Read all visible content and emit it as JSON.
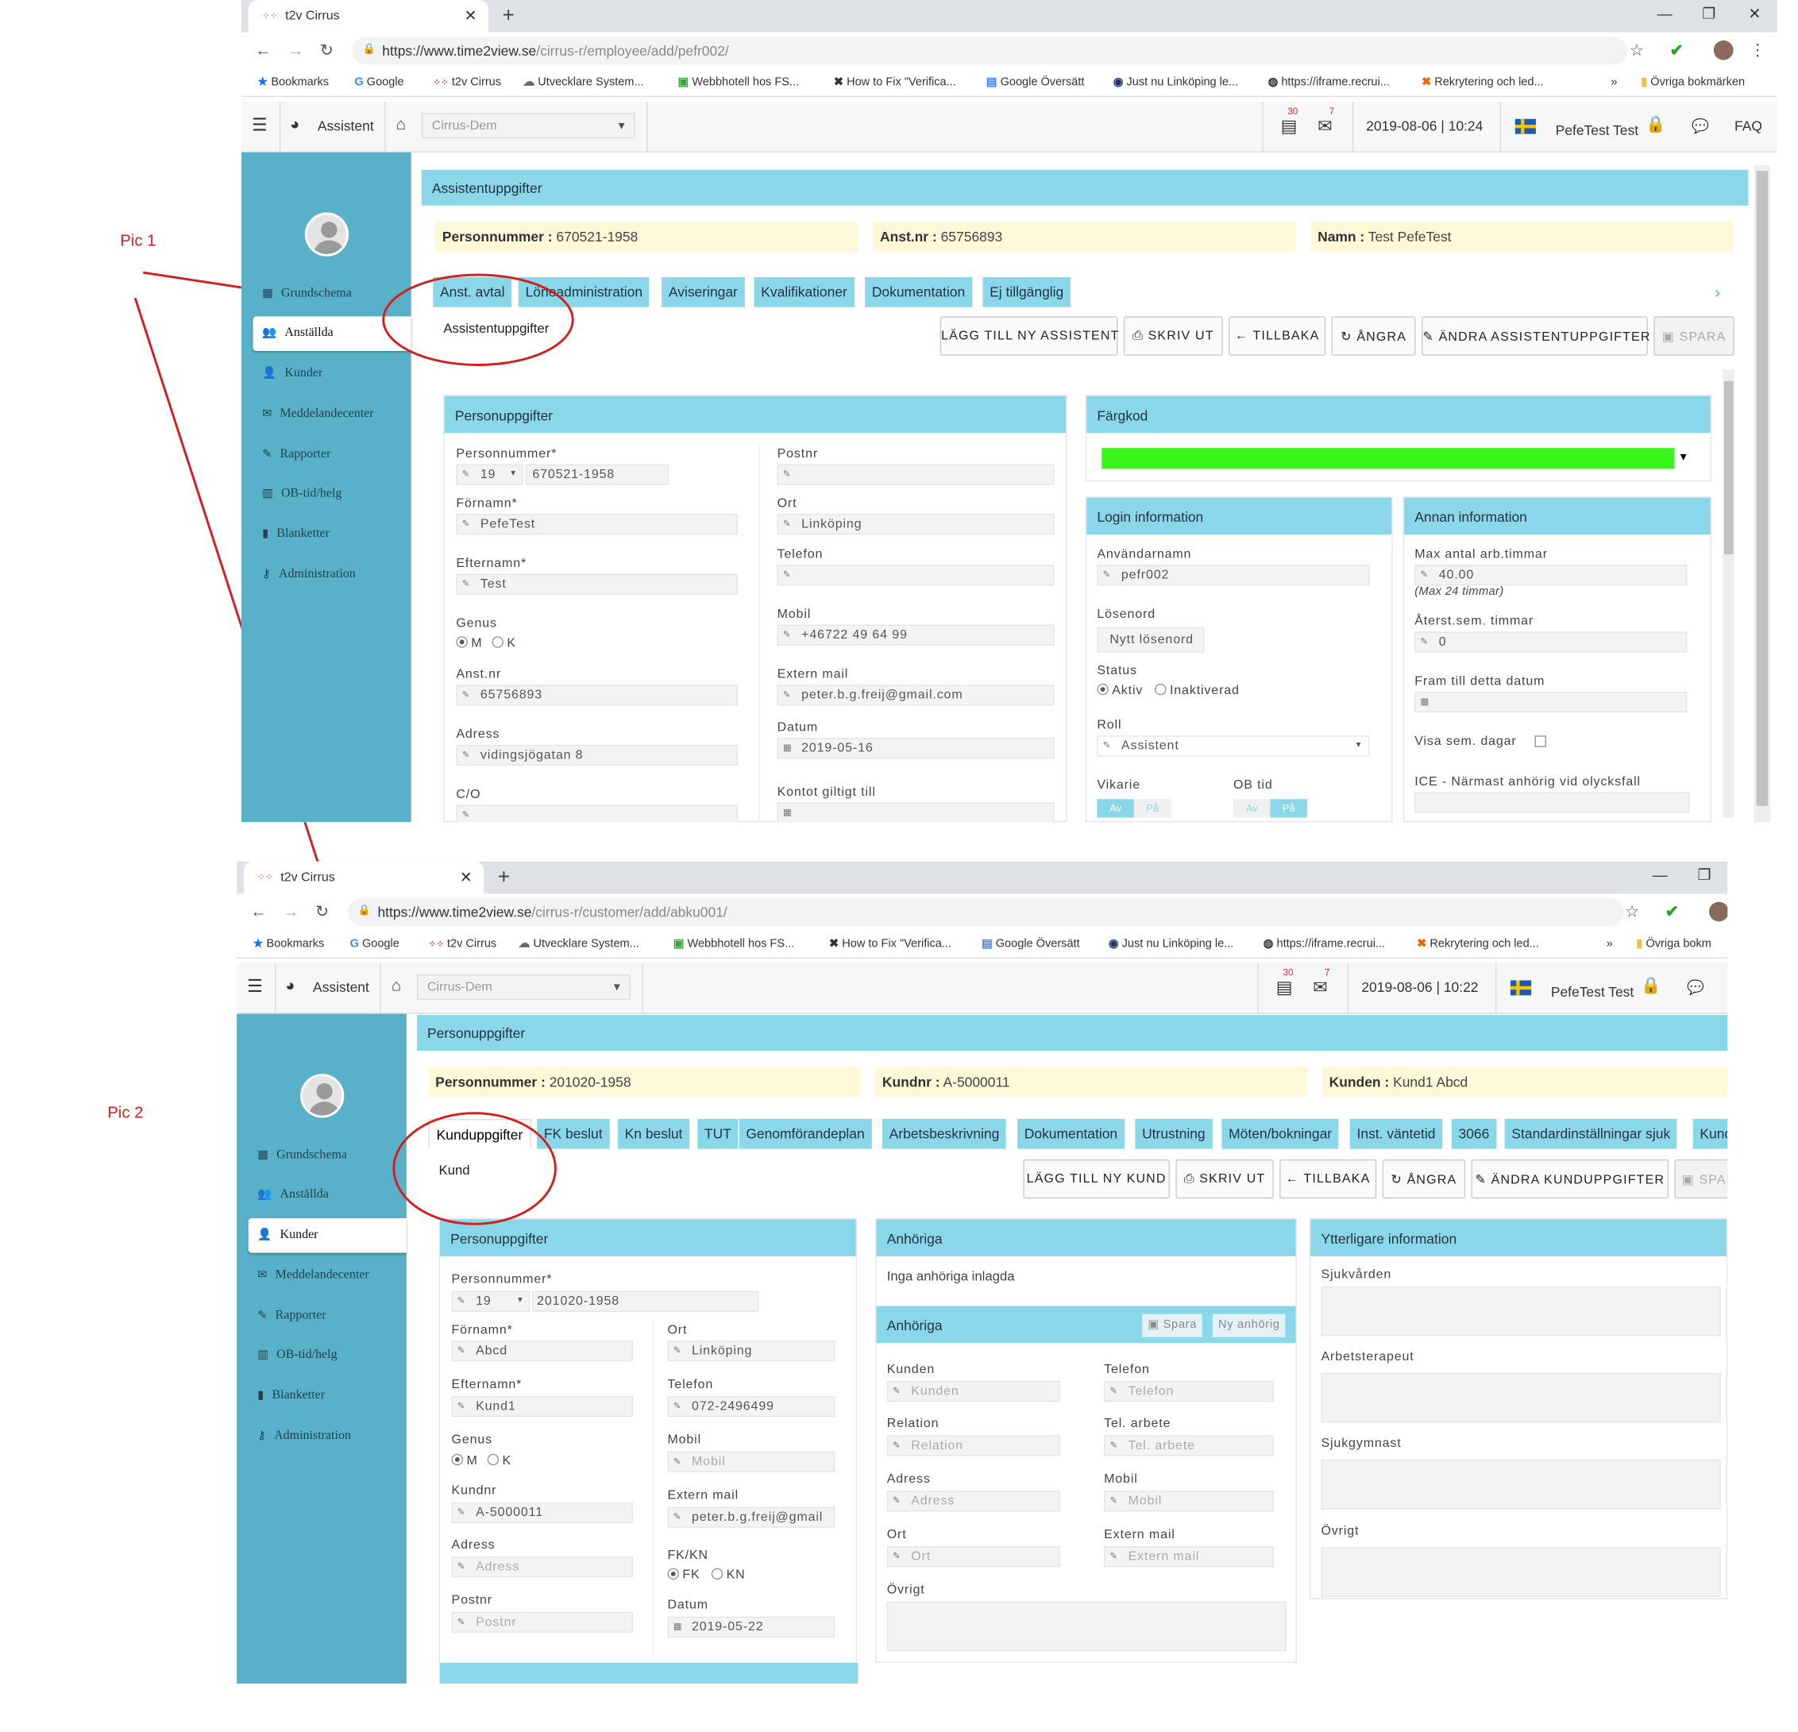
{
  "annotations": {
    "pic1": "Pic 1",
    "pic2": "Pic 2"
  },
  "colors": {
    "annotation": "#d21f1f",
    "sidebar": "#58b0c9",
    "header_blue": "#8bd7ea",
    "info_yellow": "#fcf8d8",
    "color_code": "#39f61a"
  },
  "browser": {
    "tab_title": "t2v Cirrus",
    "new_tab": "+",
    "bookmarks": [
      "Bookmarks",
      "Google",
      "t2v Cirrus",
      "Utvecklare System...",
      "Webbhotell hos FS...",
      "How to Fix \"Verifica...",
      "Google Översätt",
      "Just nu Linköping le...",
      "https://iframe.recrui...",
      "Rekrytering och led..."
    ],
    "more": "»",
    "other_bookmarks": "Övriga bokmärken",
    "other_bookmarks_cut": "Övriga bokm"
  },
  "app": {
    "module": "Assistent",
    "org_select": "Cirrus-Dem",
    "badge1": "30",
    "badge2": "7",
    "user": "PefeTest Test",
    "faq": "FAQ",
    "sidebar": [
      "Grundschema",
      "Anställda",
      "Kunder",
      "Meddelandecenter",
      "Rapporter",
      "OB-tid/helg",
      "Blanketter",
      "Administration"
    ]
  },
  "shot1": {
    "url_base": "https://www.time2view.se",
    "url_path": "/cirrus-r/employee/add/pefr002/",
    "datetime": "2019-08-06 | 10:24",
    "page_title": "Assistentuppgifter",
    "info": [
      {
        "label": "Personnummer :",
        "value": " 670521-1958"
      },
      {
        "label": "Anst.nr :",
        "value": " 65756893"
      },
      {
        "label": "Namn :",
        "value": " Test PefeTest"
      }
    ],
    "tabs": [
      "Anst. avtal",
      "Löneadministration",
      "Aviseringar",
      "Kvalifikationer",
      "Dokumentation",
      "Ej tillgänglig"
    ],
    "subtitle": "Assistentuppgifter",
    "buttons": [
      "LÄGG TILL NY ASSISTENT",
      "SKRIV UT",
      "TILLBAKA",
      "ÅNGRA",
      "ÄNDRA ASSISTENTUPPGIFTER",
      "SPARA"
    ],
    "person": {
      "header": "Personuppgifter",
      "personnummer_label": "Personnummer*",
      "century": "19",
      "personnummer": "670521-1958",
      "fornamn_label": "Förnamn*",
      "fornamn": "PefeTest",
      "efternamn_label": "Efternamn*",
      "efternamn": "Test",
      "genus_label": "Genus",
      "genus_m": "M",
      "genus_k": "K",
      "anstnr_label": "Anst.nr",
      "anstnr": "65756893",
      "adress_label": "Adress",
      "adress": "vidingsjögatan 8",
      "co_label": "C/O",
      "postnr_label": "Postnr",
      "postnr": "",
      "ort_label": "Ort",
      "ort": "Linköping",
      "telefon_label": "Telefon",
      "telefon": "",
      "mobil_label": "Mobil",
      "mobil": "+46722 49  64 99",
      "mail_label": "Extern mail",
      "mail": "peter.b.g.freij@gmail.com",
      "datum_label": "Datum",
      "datum": "2019-05-16",
      "kontot_label": "Kontot giltigt till"
    },
    "fargkod": {
      "header": "Färgkod"
    },
    "login": {
      "header": "Login information",
      "user_label": "Användarnamn",
      "user": "pefr002",
      "pw_label": "Lösenord",
      "pw_btn": "Nytt lösenord",
      "status_label": "Status",
      "status_on": "Aktiv",
      "status_off": "Inaktiverad",
      "roll_label": "Roll",
      "roll": "Assistent",
      "vikarie_label": "Vikarie",
      "ob_label": "OB tid",
      "av": "Av",
      "pa": "På"
    },
    "annan": {
      "header": "Annan information",
      "max_label": "Max antal arb.timmar",
      "max": "40.00",
      "max_hint": "(Max 24 timmar)",
      "ater_label": "Återst.sem. timmar",
      "ater": "0",
      "fram_label": "Fram till detta datum",
      "visa_label": "Visa sem. dagar",
      "ice_label": "ICE - Närmast anhörig vid olycksfall"
    }
  },
  "shot2": {
    "url_base": "https://www.time2view.se",
    "url_path": "/cirrus-r/customer/add/abku001/",
    "datetime": "2019-08-06 | 10:22",
    "page_title": "Personuppgifter",
    "info": [
      {
        "label": "Personnummer :",
        "value": " 201020-1958"
      },
      {
        "label": "Kundnr :",
        "value": " A-5000011"
      },
      {
        "label": "Kunden :",
        "value": " Kund1 Abcd"
      }
    ],
    "tabs": [
      "Kunduppgifter",
      "FK beslut",
      "Kn beslut",
      "TUT",
      "Genomförandeplan",
      "Arbetsbeskrivning",
      "Dokumentation",
      "Utrustning",
      "Möten/bokningar",
      "Inst. väntetid",
      "3066",
      "Standardinställningar sjuk",
      "Kund"
    ],
    "subtitle": "Kund",
    "buttons": [
      "LÄGG TILL NY KUND",
      "SKRIV UT",
      "TILLBAKA",
      "ÅNGRA",
      "ÄNDRA KUNDUPPGIFTER",
      "SPAR"
    ],
    "person": {
      "header": "Personuppgifter",
      "personnummer_label": "Personnummer*",
      "century": "19",
      "personnummer": "201020-1958",
      "fornamn_label": "Förnamn*",
      "fornamn": "Abcd",
      "efternamn_label": "Efternamn*",
      "efternamn": "Kund1",
      "genus_label": "Genus",
      "genus_m": "M",
      "genus_k": "K",
      "kundnr_label": "Kundnr",
      "kundnr": "A-5000011",
      "adress_label": "Adress",
      "adress_ph": "Adress",
      "postnr_label": "Postnr",
      "postnr_ph": "Postnr",
      "ort_label": "Ort",
      "ort": "Linköping",
      "telefon_label": "Telefon",
      "telefon": "072-2496499",
      "mobil_label": "Mobil",
      "mobil_ph": "Mobil",
      "mail_label": "Extern mail",
      "mail": "peter.b.g.freij@gmail",
      "fkkn_label": "FK/KN",
      "fk": "FK",
      "kn": "KN",
      "datum_label": "Datum",
      "datum": "2019-05-22"
    },
    "anhoriga": {
      "header": "Anhöriga",
      "none": "Inga anhöriga inlagda",
      "sub_header": "Anhöriga",
      "save": "Spara",
      "new": "Ny anhörig",
      "kunden_label": "Kunden",
      "kunden_ph": "Kunden",
      "telefon_label": "Telefon",
      "telefon_ph": "Telefon",
      "relation_label": "Relation",
      "relation_ph": "Relation",
      "telarb_label": "Tel. arbete",
      "telarb_ph": "Tel. arbete",
      "adress_label": "Adress",
      "adress_ph": "Adress",
      "mobil_label": "Mobil",
      "mobil_ph": "Mobil",
      "ort_label": "Ort",
      "ort_ph": "Ort",
      "mail_label": "Extern mail",
      "mail_ph": "Extern mail",
      "ovrigt_label": "Övrigt"
    },
    "ytterligare": {
      "header": "Ytterligare information",
      "f1": "Sjukvården",
      "f2": "Arbetsterapeut",
      "f3": "Sjukgymnast",
      "f4": "Övrigt"
    }
  }
}
